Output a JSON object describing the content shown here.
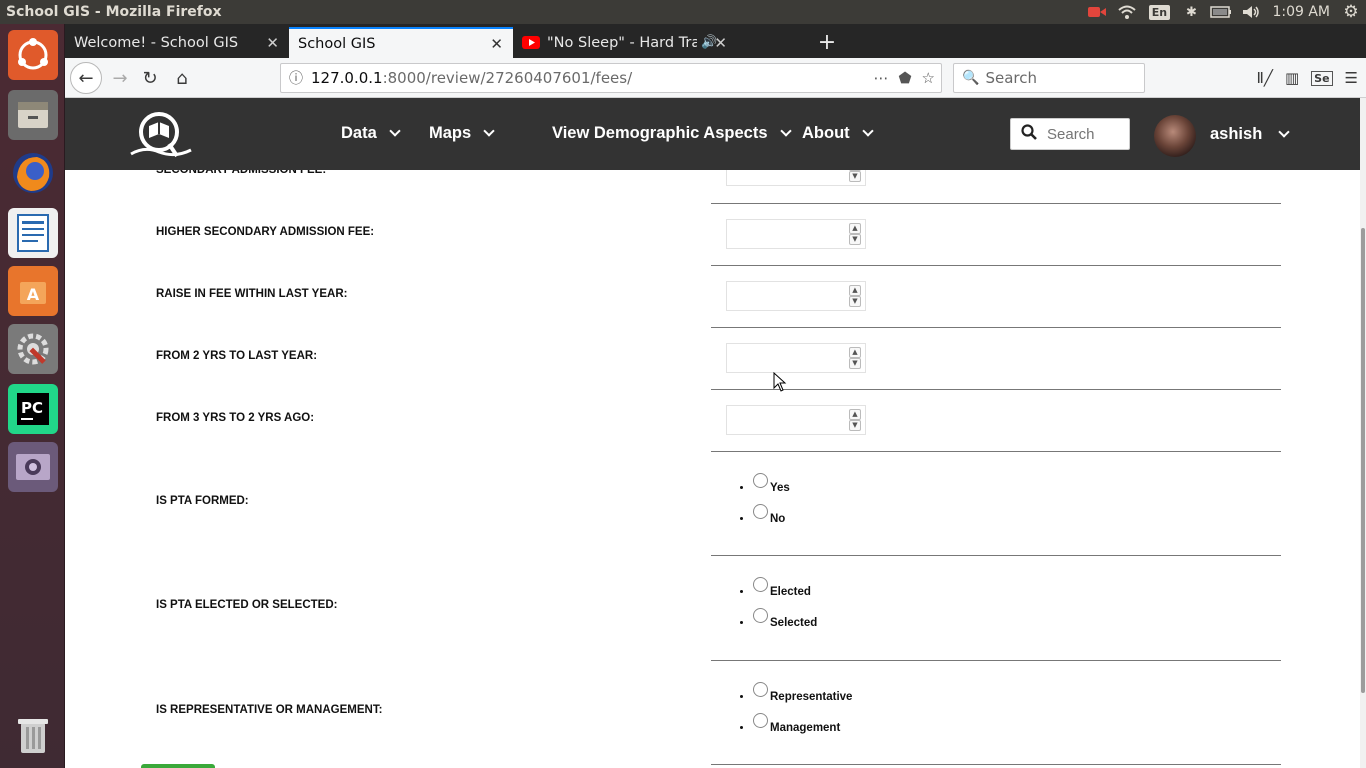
{
  "os": {
    "window_title": "School GIS - Mozilla Firefox",
    "keyboard_layout": "En",
    "clock": "1:09 AM"
  },
  "browser": {
    "tabs": [
      {
        "label": "Welcome! - School GIS",
        "active": false
      },
      {
        "label": "School GIS",
        "active": true
      },
      {
        "label": "\"No Sleep\" - Hard Trap",
        "active": false
      }
    ],
    "url_host": "127.0.0.1",
    "url_path": ":8000/review/27260407601/fees/",
    "search_placeholder": "Search"
  },
  "site": {
    "nav": {
      "menu": [
        "Data",
        "Maps",
        "View Demographic Aspects",
        "About"
      ],
      "search_placeholder": "Search",
      "username": "ashish"
    },
    "form": {
      "secondary_label": "SECONDARY ADMISSION FEE:",
      "fields": [
        {
          "label": "HIGHER SECONDARY ADMISSION FEE:",
          "value": ""
        },
        {
          "label": "RAISE IN FEE WITHIN LAST YEAR:",
          "value": ""
        },
        {
          "label": "FROM 2 YRS TO LAST YEAR:",
          "value": ""
        },
        {
          "label": "FROM 3 YRS TO 2 YRS AGO:",
          "value": ""
        }
      ],
      "radios": [
        {
          "label": "IS PTA FORMED:",
          "options": [
            "Yes",
            "No"
          ]
        },
        {
          "label": "IS PTA ELECTED OR SELECTED:",
          "options": [
            "Elected",
            "Selected"
          ]
        },
        {
          "label": "IS REPRESENTATIVE OR MANAGEMENT:",
          "options": [
            "Representative",
            "Management"
          ]
        }
      ]
    }
  },
  "colors": {
    "site_nav_bg": "#333333",
    "tab_accent": "#0a84ff",
    "submit_green": "#3aa93a"
  }
}
